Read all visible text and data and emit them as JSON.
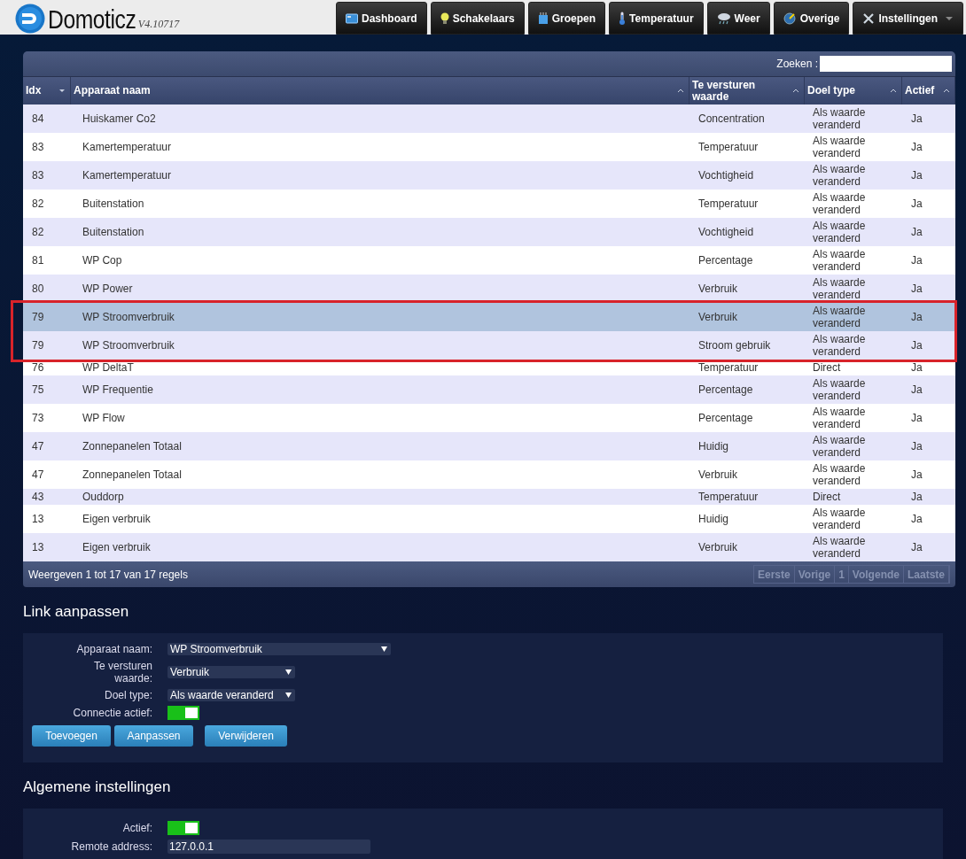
{
  "header": {
    "logo_text": "Domoticz",
    "version": "V4.10717",
    "nav": [
      {
        "label": "Dashboard",
        "dropdown": false
      },
      {
        "label": "Schakelaars",
        "dropdown": false
      },
      {
        "label": "Groepen",
        "dropdown": false
      },
      {
        "label": "Temperatuur",
        "dropdown": false
      },
      {
        "label": "Weer",
        "dropdown": false
      },
      {
        "label": "Overige",
        "dropdown": false
      },
      {
        "label": "Instellingen",
        "dropdown": true
      }
    ]
  },
  "table": {
    "search": {
      "label": "Zoeken :"
    },
    "columns": [
      {
        "label": "Idx"
      },
      {
        "label": "Apparaat naam"
      },
      {
        "label": "Te versturen waarde"
      },
      {
        "label": "Doel type"
      },
      {
        "label": "Actief"
      }
    ],
    "rows": [
      {
        "idx": "84",
        "name": "Huiskamer Co2",
        "value": "Concentration",
        "target": "Als waarde veranderd",
        "active": "Ja",
        "selected": false,
        "framed": false
      },
      {
        "idx": "83",
        "name": "Kamertemperatuur",
        "value": "Temperatuur",
        "target": "Als waarde veranderd",
        "active": "Ja",
        "selected": false,
        "framed": false
      },
      {
        "idx": "83",
        "name": "Kamertemperatuur",
        "value": "Vochtigheid",
        "target": "Als waarde veranderd",
        "active": "Ja",
        "selected": false,
        "framed": false
      },
      {
        "idx": "82",
        "name": "Buitenstation",
        "value": "Temperatuur",
        "target": "Als waarde veranderd",
        "active": "Ja",
        "selected": false,
        "framed": false
      },
      {
        "idx": "82",
        "name": "Buitenstation",
        "value": "Vochtigheid",
        "target": "Als waarde veranderd",
        "active": "Ja",
        "selected": false,
        "framed": false
      },
      {
        "idx": "81",
        "name": "WP Cop",
        "value": "Percentage",
        "target": "Als waarde veranderd",
        "active": "Ja",
        "selected": false,
        "framed": false
      },
      {
        "idx": "80",
        "name": "WP Power",
        "value": "Verbruik",
        "target": "Als waarde veranderd",
        "active": "Ja",
        "selected": false,
        "framed": false
      },
      {
        "idx": "79",
        "name": "WP Stroomverbruik",
        "value": "Verbruik",
        "target": "Als waarde veranderd",
        "active": "Ja",
        "selected": true,
        "framed": true
      },
      {
        "idx": "79",
        "name": "WP Stroomverbruik",
        "value": "Stroom gebruik",
        "target": "Als waarde veranderd",
        "active": "Ja",
        "selected": false,
        "framed": true
      },
      {
        "idx": "76",
        "name": "WP DeltaT",
        "value": "Temperatuur",
        "target": "Direct",
        "active": "Ja",
        "selected": false,
        "framed": false
      },
      {
        "idx": "75",
        "name": "WP Frequentie",
        "value": "Percentage",
        "target": "Als waarde veranderd",
        "active": "Ja",
        "selected": false,
        "framed": false
      },
      {
        "idx": "73",
        "name": "WP Flow",
        "value": "Percentage",
        "target": "Als waarde veranderd",
        "active": "Ja",
        "selected": false,
        "framed": false
      },
      {
        "idx": "47",
        "name": "Zonnepanelen Totaal",
        "value": "Huidig",
        "target": "Als waarde veranderd",
        "active": "Ja",
        "selected": false,
        "framed": false
      },
      {
        "idx": "47",
        "name": "Zonnepanelen Totaal",
        "value": "Verbruik",
        "target": "Als waarde veranderd",
        "active": "Ja",
        "selected": false,
        "framed": false
      },
      {
        "idx": "43",
        "name": "Ouddorp",
        "value": "Temperatuur",
        "target": "Direct",
        "active": "Ja",
        "selected": false,
        "framed": false
      },
      {
        "idx": "13",
        "name": "Eigen verbruik",
        "value": "Huidig",
        "target": "Als waarde veranderd",
        "active": "Ja",
        "selected": false,
        "framed": false
      },
      {
        "idx": "13",
        "name": "Eigen verbruik",
        "value": "Verbruik",
        "target": "Als waarde veranderd",
        "active": "Ja",
        "selected": false,
        "framed": false
      }
    ],
    "info": "Weergeven 1 tot 17 van 17 regels",
    "pagination": [
      {
        "label": "Eerste",
        "disabled": true
      },
      {
        "label": "Vorige",
        "disabled": true
      },
      {
        "label": "1",
        "disabled": true
      },
      {
        "label": "Volgende",
        "disabled": true
      },
      {
        "label": "Laatste",
        "disabled": true
      }
    ]
  },
  "link_form": {
    "title": "Link aanpassen",
    "fields": [
      {
        "kind": "select",
        "label": "Apparaat naam:",
        "value": "WP Stroomverbruik"
      },
      {
        "kind": "select",
        "label": "Te versturen waarde:",
        "value": "Verbruik"
      },
      {
        "kind": "select",
        "label": "Doel type:",
        "value": "Als waarde veranderd"
      },
      {
        "kind": "toggle",
        "label": "Connectie actief:",
        "on": true
      }
    ],
    "buttons": [
      "Toevoegen",
      "Aanpassen",
      "Verwijderen"
    ]
  },
  "general": {
    "title": "Algemene instellingen",
    "fields": [
      {
        "kind": "toggle",
        "label": "Actief:",
        "on": true
      },
      {
        "kind": "text",
        "label": "Remote address:",
        "value": "127.0.0.1"
      }
    ]
  }
}
